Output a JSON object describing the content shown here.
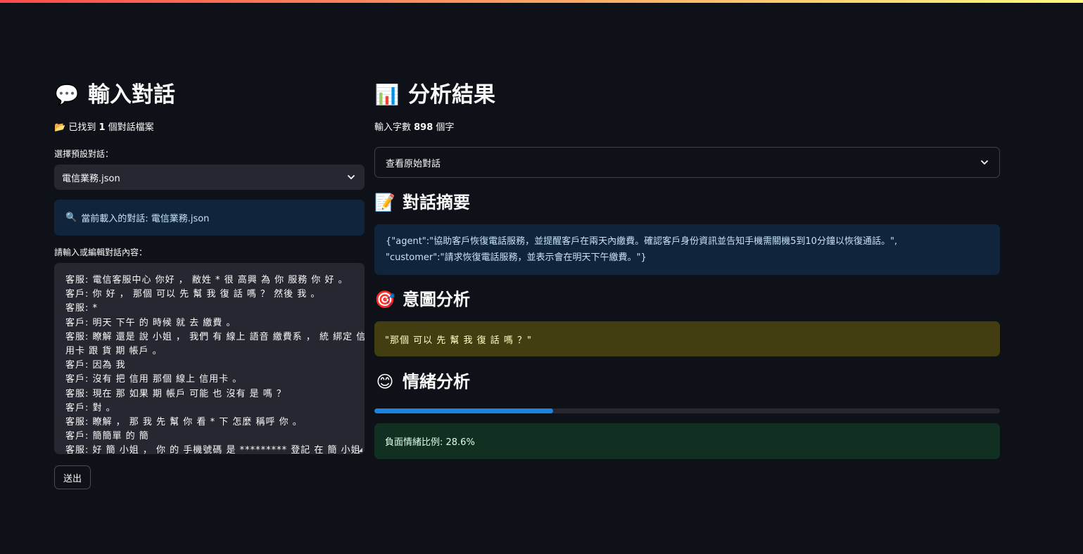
{
  "left": {
    "title_icon": "speech-balloon-icon",
    "title": "輸入對話",
    "files_found_prefix": "已找到 ",
    "files_found_count": "1",
    "files_found_suffix": " 個對話檔案",
    "select_label": "選擇預設對話：",
    "select_value": "電信業務.json",
    "loaded_info": "當前載入的對話: 電信業務.json",
    "textarea_label": "請輸入或編輯對話內容：",
    "dialogue_lines": [
      "客服: 電信客服中心 你好 ， 敝姓 * 很 高興 為 你 服務 你 好 。",
      "客戶: 你 好 ， 那個 可以 先 幫 我 復 話 嗎 ？ 然後 我 。",
      "客服: *",
      "客戶: 明天 下午 的 時候 就 去 繳費 。",
      "客服: 瞭解 還是 說 小姐 ， 我們 有 線上 語音 繳費系 ， 統 綁定 信",
      "用卡 跟 貨 期 帳戶 。",
      "客戶: 因為 我",
      "客戶: 沒有 把 信用 那個 線上 信用卡 。",
      "客服: 現在 那 如果 期 帳戶 可能 也 沒有 是 嗎 ？",
      "客戶: 對 。",
      "客服: 瞭解 ， 那 我 先 幫 你 看 * 下 怎麼 稱呼 你 。",
      "客戶: 簡簡單 的 簡",
      "客服: 好 簡 小姐 ， 你 的 手機號碼 是 ********* 登記 在 簡 小姐 本"
    ],
    "submit_label": "送出"
  },
  "right": {
    "title_icon": "bar-chart-icon",
    "title": "分析結果",
    "char_count_prefix": "輸入字數 ",
    "char_count_value": "898",
    "char_count_suffix": " 個字",
    "expander_label": "查看原始對話",
    "summary_icon": "memo-icon",
    "summary_title": "對話摘要",
    "summary_line1": "{\"agent\":\"協助客戶恢復電話服務，並提醒客戶在兩天內繳費。確認客戶身份資訊並告知手機需關機5到10分鐘以恢復通話。\",",
    "summary_line2": "\"customer\":\"請求恢復電話服務，並表示會在明天下午繳費。\"}",
    "intent_icon": "direct-hit-icon",
    "intent_title": "意圖分析",
    "intent_text": "\"那個 可以 先 幫 我 復 話 嗎 ？\"",
    "sentiment_icon": "smiling-face-icon",
    "sentiment_title": "情緒分析",
    "negative_ratio": 0.286,
    "negative_ratio_text": "負面情緒比例: 28.6%"
  },
  "colors": {
    "background": "#0e1117",
    "progress": "#1c83e1",
    "top_gradient_start": "#ff4b4b",
    "top_gradient_end": "#fffd80"
  }
}
